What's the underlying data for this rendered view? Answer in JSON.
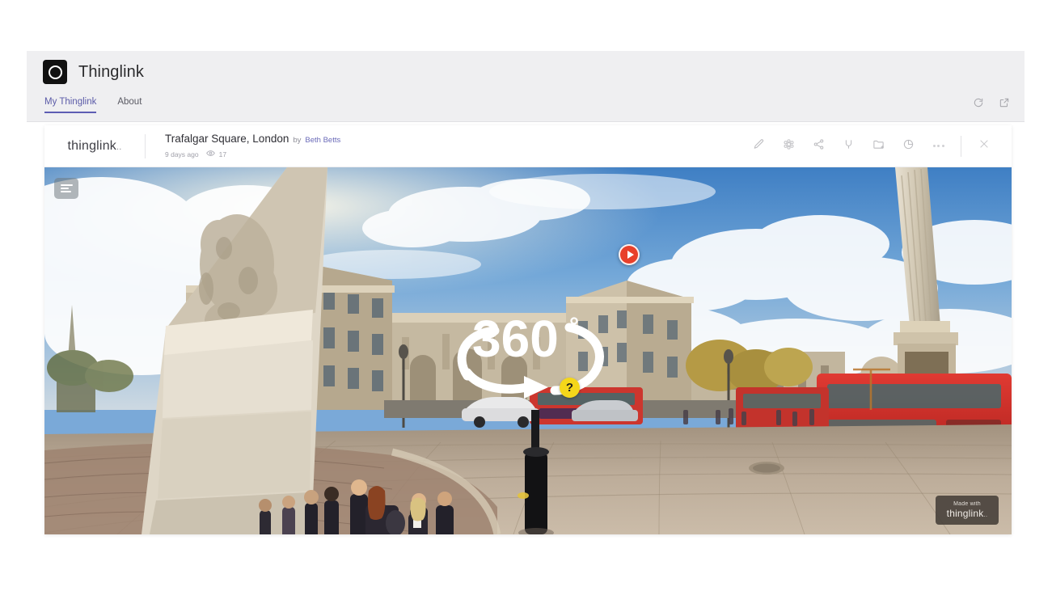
{
  "app": {
    "brand_name": "Thinglink",
    "logo_icon": "thinglink-ring-logo",
    "tabs": [
      {
        "label": "My Thinglink",
        "active": true
      },
      {
        "label": "About",
        "active": false
      }
    ],
    "actions": [
      {
        "icon": "refresh-icon",
        "name": "refresh-button"
      },
      {
        "icon": "open-external-icon",
        "name": "open-external-button"
      }
    ]
  },
  "card": {
    "wordmark": "thinglink",
    "wordmark_dots": "..",
    "title": "Trafalgar Square, London",
    "by_label": "by",
    "author": "Beth Betts",
    "timestamp": "9 days ago",
    "views_icon": "eye-icon",
    "views_count": "17",
    "tools": [
      {
        "name": "edit-button",
        "icon": "pencil-icon"
      },
      {
        "name": "settings-button",
        "icon": "gear-icon"
      },
      {
        "name": "share-button",
        "icon": "share-icon"
      },
      {
        "name": "tag-button",
        "icon": "tag-icon"
      },
      {
        "name": "add-to-folder-button",
        "icon": "folder-add-icon"
      },
      {
        "name": "stats-button",
        "icon": "pie-chart-icon"
      },
      {
        "name": "more-options-button",
        "icon": "ellipsis-icon"
      },
      {
        "name": "close-button",
        "icon": "close-icon"
      }
    ]
  },
  "scene": {
    "alt": "360 degree panorama of Trafalgar Square, London with Nelson's Column, Admiralty Arch, red double-decker buses and a crowd of students",
    "notes_button": "notes-button",
    "overlay_360_label": "360",
    "overlay_360_symbol": "°",
    "help_tag_label": "?",
    "play_tag": "play-tag",
    "watermark_top": "Made with",
    "watermark_name": "thinglink",
    "watermark_dots": ".."
  },
  "colors": {
    "accent": "#5e5eb4",
    "play_tag": "#e8402a",
    "help_tag": "#f5d71a",
    "app_bg": "#efeff1",
    "card_bg": "#ffffff"
  }
}
